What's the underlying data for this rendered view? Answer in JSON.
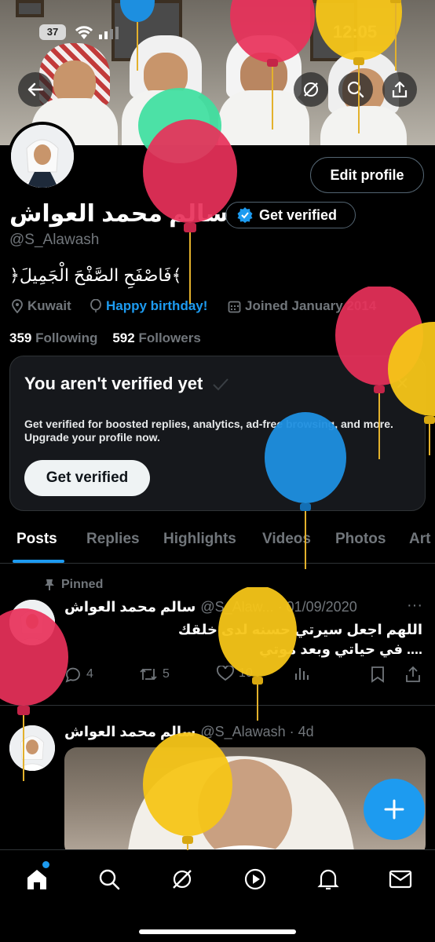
{
  "status_bar": {
    "battery": "37",
    "time": "12:05"
  },
  "profile": {
    "name": "سالم محمد العواش",
    "handle": "@S_Alawash",
    "bio": "﴿فَاصْفَحِ الصَّفْحَ الْجَمِيلَ﴾",
    "location": "Kuwait",
    "birthday_link": "Happy birthday!",
    "joined": "Joined January 2014",
    "following_count": "359",
    "following_label": "Following",
    "followers_count": "592",
    "followers_label": "Followers",
    "edit_profile_label": "Edit profile",
    "get_verified_label": "Get verified"
  },
  "verify_card": {
    "title": "You aren't verified yet",
    "text": "Get verified for boosted replies, analytics, ad-free browsing, and more. Upgrade your profile now.",
    "button": "Get verified"
  },
  "tabs": [
    "Posts",
    "Replies",
    "Highlights",
    "Videos",
    "Photos",
    "Art"
  ],
  "posts": [
    {
      "pinned_label": "Pinned",
      "author": "سالم محمد العواش",
      "handle_date": "@S_Alaw... · 01/09/2020",
      "text_line1": "اللهم اجعل سيرتي حسنه لدى خلقك",
      "text_line2": "في حياتي وبعد موتي ....",
      "replies": "4",
      "reposts": "5",
      "likes": "10"
    },
    {
      "author": "سالم محمد العواش",
      "handle_date": "@S_Alawash · 4d"
    }
  ],
  "colors": {
    "accent": "#1d9bf0",
    "background": "#000000",
    "muted": "#71767b",
    "balloon_red": "#e8315a",
    "balloon_yellow": "#f5c518",
    "balloon_blue": "#1d8fe0",
    "balloon_green": "#3ee0a0"
  }
}
